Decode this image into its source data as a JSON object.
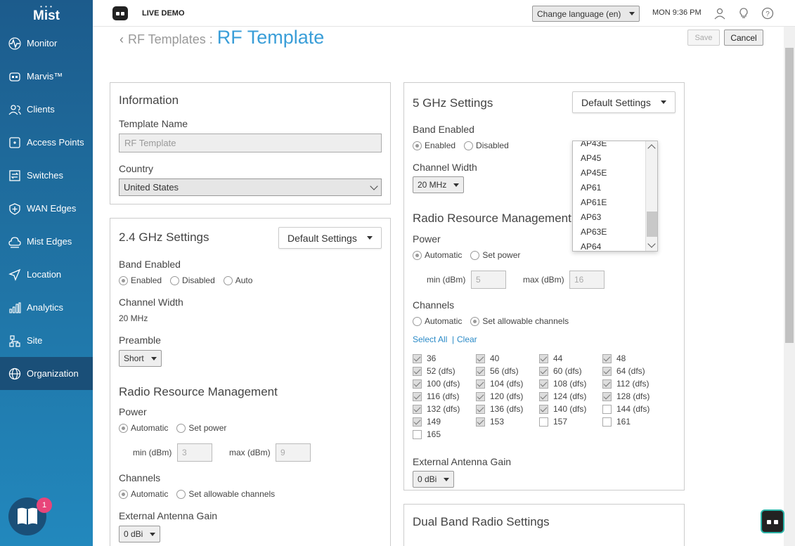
{
  "brand": {
    "dots": "• • •",
    "name": "Mist"
  },
  "sidebar": {
    "items": [
      {
        "label": "Monitor",
        "icon": "monitor-icon"
      },
      {
        "label": "Marvis™",
        "icon": "marvis-icon"
      },
      {
        "label": "Clients",
        "icon": "clients-icon"
      },
      {
        "label": "Access Points",
        "icon": "access-points-icon"
      },
      {
        "label": "Switches",
        "icon": "switches-icon"
      },
      {
        "label": "WAN Edges",
        "icon": "wan-edges-icon"
      },
      {
        "label": "Mist Edges",
        "icon": "mist-edges-icon"
      },
      {
        "label": "Location",
        "icon": "location-icon"
      },
      {
        "label": "Analytics",
        "icon": "analytics-icon"
      },
      {
        "label": "Site",
        "icon": "site-icon"
      },
      {
        "label": "Organization",
        "icon": "organization-icon"
      }
    ],
    "chat_badge": "1"
  },
  "topbar": {
    "org": "LIVE DEMO",
    "language": "Change language (en)",
    "clock": "MON 9:36 PM"
  },
  "page": {
    "breadcrumb_parent": "RF Templates :",
    "title": "RF Template",
    "save": "Save",
    "cancel": "Cancel"
  },
  "info": {
    "title": "Information",
    "template_name_label": "Template Name",
    "template_name_value": "RF Template",
    "country_label": "Country",
    "country_value": "United States"
  },
  "band24": {
    "title": "2.4 GHz Settings",
    "default_btn": "Default Settings",
    "band_enabled": "Band Enabled",
    "opt_enabled": "Enabled",
    "opt_disabled": "Disabled",
    "opt_auto": "Auto",
    "channel_width_label": "Channel Width",
    "channel_width_value": "20 MHz",
    "preamble_label": "Preamble",
    "preamble_value": "Short",
    "rrm": "Radio Resource Management",
    "power": "Power",
    "power_auto": "Automatic",
    "power_set": "Set power",
    "min_label": "min (dBm)",
    "min_value": "3",
    "max_label": "max (dBm)",
    "max_value": "9",
    "channels": "Channels",
    "ch_auto": "Automatic",
    "ch_set": "Set allowable channels",
    "antenna_label": "External Antenna Gain",
    "antenna_value": "0 dBi"
  },
  "band5": {
    "title": "5 GHz Settings",
    "default_btn": "Default Settings",
    "band_enabled": "Band Enabled",
    "opt_enabled": "Enabled",
    "opt_disabled": "Disabled",
    "channel_width_label": "Channel Width",
    "channel_width_value": "20 MHz",
    "rrm": "Radio Resource Management",
    "power": "Power",
    "power_auto": "Automatic",
    "power_set": "Set power",
    "min_label": "min (dBm)",
    "min_value": "5",
    "max_label": "max (dBm)",
    "max_value": "16",
    "channels": "Channels",
    "ch_auto": "Automatic",
    "ch_set": "Set allowable channels",
    "select_all": "Select All",
    "sep": "|",
    "clear": "Clear",
    "channel_list": [
      {
        "label": "36",
        "checked": true
      },
      {
        "label": "40",
        "checked": true
      },
      {
        "label": "44",
        "checked": true
      },
      {
        "label": "48",
        "checked": true
      },
      {
        "label": "52 (dfs)",
        "checked": true
      },
      {
        "label": "56 (dfs)",
        "checked": true
      },
      {
        "label": "60 (dfs)",
        "checked": true
      },
      {
        "label": "64 (dfs)",
        "checked": true
      },
      {
        "label": "100 (dfs)",
        "checked": true
      },
      {
        "label": "104 (dfs)",
        "checked": true
      },
      {
        "label": "108 (dfs)",
        "checked": true
      },
      {
        "label": "112 (dfs)",
        "checked": true
      },
      {
        "label": "116 (dfs)",
        "checked": true
      },
      {
        "label": "120 (dfs)",
        "checked": true
      },
      {
        "label": "124 (dfs)",
        "checked": true
      },
      {
        "label": "128 (dfs)",
        "checked": true
      },
      {
        "label": "132 (dfs)",
        "checked": true
      },
      {
        "label": "136 (dfs)",
        "checked": true
      },
      {
        "label": "140 (dfs)",
        "checked": true
      },
      {
        "label": "144 (dfs)",
        "checked": false
      },
      {
        "label": "149",
        "checked": true
      },
      {
        "label": "153",
        "checked": true
      },
      {
        "label": "157",
        "checked": false
      },
      {
        "label": "161",
        "checked": false
      },
      {
        "label": "165",
        "checked": false
      }
    ],
    "antenna_label": "External Antenna Gain",
    "antenna_value": "0 dBi"
  },
  "dropdown": {
    "items": [
      "AP43E",
      "AP45",
      "AP45E",
      "AP61",
      "AP61E",
      "AP63",
      "AP63E",
      "AP64"
    ]
  },
  "dual": {
    "title": "Dual Band Radio Settings"
  }
}
